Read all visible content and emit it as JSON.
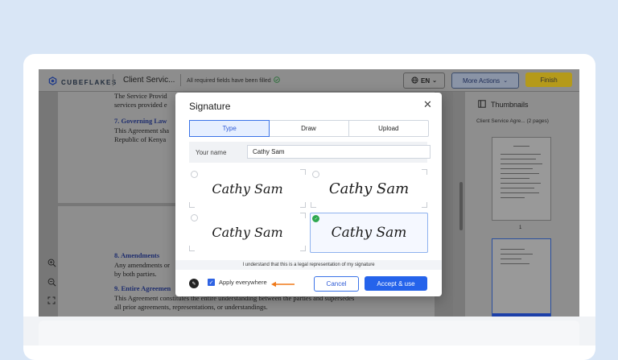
{
  "app": {
    "logo_text": "CUBEFLAKES",
    "doc_title": "Client Servic...",
    "status": "All required fields have been filled",
    "lang": "EN",
    "more_actions": "More Actions",
    "finish": "Finish"
  },
  "document": {
    "p1_line1": "The Service Provid",
    "p1_line2": "services provided e",
    "h7": "7. Governing Law",
    "p7_line1": "This Agreement sha",
    "p7_line2": "Republic of Kenya",
    "h8": "8. Amendments",
    "p8_line1": "Any amendments or",
    "p8_line2": "by both parties.",
    "h9": "9. Entire Agreemen",
    "p9_line1": "This Agreement constitutes the entire understanding between the parties and supersedes",
    "p9_line2": "all prior agreements, representations, or understandings."
  },
  "thumbnails": {
    "heading": "Thumbnails",
    "doc_name": "Client Service Agre... (2 pages)",
    "page1_number": "1"
  },
  "modal": {
    "title": "Signature",
    "tabs": [
      {
        "label": "Type"
      },
      {
        "label": "Draw"
      },
      {
        "label": "Upload"
      }
    ],
    "name_label": "Your name",
    "name_value": "Cathy Sam",
    "signatures": [
      {
        "text": "Cathy Sam"
      },
      {
        "text": "Cathy Sam"
      },
      {
        "text": "Cathy Sam"
      },
      {
        "text": "Cathy Sam"
      }
    ],
    "legal_text": "I understand that this is a legal representation of my signature",
    "apply_everywhere": "Apply everywhere",
    "cancel": "Cancel",
    "accept": "Accept & use"
  },
  "colors": {
    "primary": "#2563eb",
    "success": "#2fa84f",
    "arrow": "#f07a1a"
  }
}
